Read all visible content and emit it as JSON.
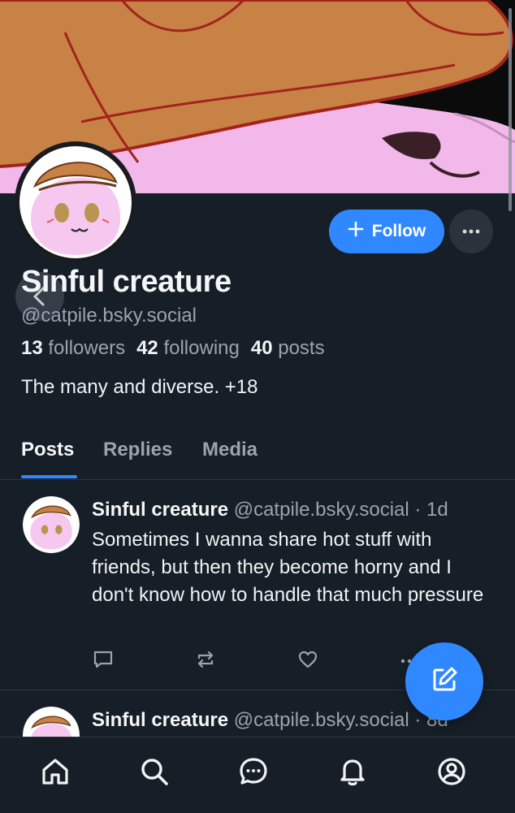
{
  "profile": {
    "display_name": "Sinful creature",
    "handle": "@catpile.bsky.social",
    "followers_count": "13",
    "followers_label": "followers",
    "following_count": "42",
    "following_label": "following",
    "posts_count": "40",
    "posts_label": "posts",
    "bio": "The many and diverse. +18"
  },
  "actions": {
    "follow_label": "Follow",
    "follow_icon": "plus-icon",
    "more_icon": "ellipsis-icon"
  },
  "tabs": [
    {
      "label": "Posts",
      "active": true
    },
    {
      "label": "Replies",
      "active": false
    },
    {
      "label": "Media",
      "active": false
    }
  ],
  "posts": [
    {
      "author": "Sinful creature",
      "handle": "@catpile.bsky.social",
      "time": "· 1d",
      "text": "Sometimes I wanna share hot stuff with friends, but then they become horny and I don't know how to handle that much pressure"
    },
    {
      "author": "Sinful creature",
      "handle": "@catpile.bsky.social",
      "time": "· 8d",
      "text": ""
    }
  ],
  "bottom_nav": [
    "home-icon",
    "search-icon",
    "chat-icon",
    "bell-icon",
    "profile-icon"
  ],
  "colors": {
    "background": "#161e27",
    "accent": "#2f88ff",
    "muted_text": "#9aa4ae"
  }
}
